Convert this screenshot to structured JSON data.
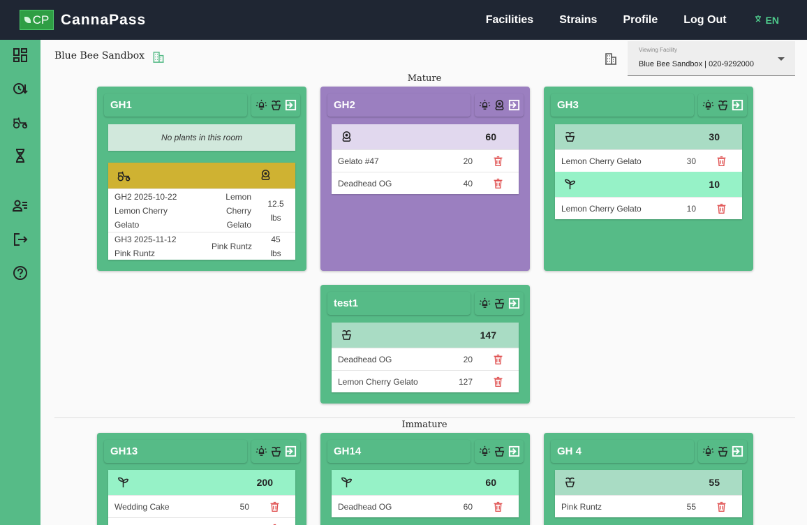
{
  "app": {
    "logo_text": "CP",
    "name": "CannaPass"
  },
  "nav": {
    "facilities": "Facilities",
    "strains": "Strains",
    "profile": "Profile",
    "logout": "Log Out",
    "language": "EN"
  },
  "facility": {
    "title": "Blue Bee Sandbox",
    "select_label": "Viewing Facility",
    "select_value": "Blue Bee Sandbox | 020-9292000"
  },
  "sections": {
    "mature": "Mature",
    "immature": "Immature"
  },
  "rooms": {
    "gh1": {
      "name": "GH1",
      "empty_text": "No plants in this room",
      "harvests": [
        {
          "label": "GH2 2025-10-22 Lemon Cherry Gelato",
          "strain": "Lemon Cherry Gelato",
          "weight": "12.5 lbs"
        },
        {
          "label": "GH3 2025-11-12 Pink Runtz",
          "strain": "Pink Runtz",
          "weight": "45 lbs"
        }
      ]
    },
    "gh2": {
      "name": "GH2",
      "groups": [
        {
          "stage": "flowering",
          "total": "60",
          "rows": [
            {
              "strain": "Gelato #47",
              "count": "20"
            },
            {
              "strain": "Deadhead OG",
              "count": "40"
            }
          ]
        }
      ]
    },
    "gh3": {
      "name": "GH3",
      "groups": [
        {
          "stage": "vegetative",
          "total": "30",
          "rows": [
            {
              "strain": "Lemon Cherry Gelato",
              "count": "30"
            }
          ]
        },
        {
          "stage": "seedling",
          "total": "10",
          "rows": [
            {
              "strain": "Lemon Cherry Gelato",
              "count": "10"
            }
          ]
        }
      ]
    },
    "test1": {
      "name": "test1",
      "groups": [
        {
          "stage": "vegetative",
          "total": "147",
          "rows": [
            {
              "strain": "Deadhead OG",
              "count": "20"
            },
            {
              "strain": "Lemon Cherry Gelato",
              "count": "127"
            }
          ]
        }
      ]
    },
    "gh13": {
      "name": "GH13",
      "groups": [
        {
          "stage": "seedling",
          "total": "200",
          "rows": [
            {
              "strain": "Wedding Cake",
              "count": "50"
            }
          ]
        }
      ]
    },
    "gh14": {
      "name": "GH14",
      "groups": [
        {
          "stage": "seedling",
          "total": "60",
          "rows": [
            {
              "strain": "Deadhead OG",
              "count": "60"
            }
          ]
        }
      ]
    },
    "gh4": {
      "name": "GH 4",
      "groups": [
        {
          "stage": "vegetative",
          "total": "55",
          "rows": [
            {
              "strain": "Pink Runtz",
              "count": "55"
            }
          ]
        }
      ]
    }
  },
  "colors": {
    "topbar": "#1f2633",
    "sidebar": "#56bb87",
    "room_green": "#56bb87",
    "room_purple": "#9b7fc0",
    "veg_header": "#a9dcc4",
    "seedling_header": "#96f2c7",
    "flower_header": "#e1d8ee",
    "harvest_header": "#cfb232",
    "trash": "#e05252"
  }
}
